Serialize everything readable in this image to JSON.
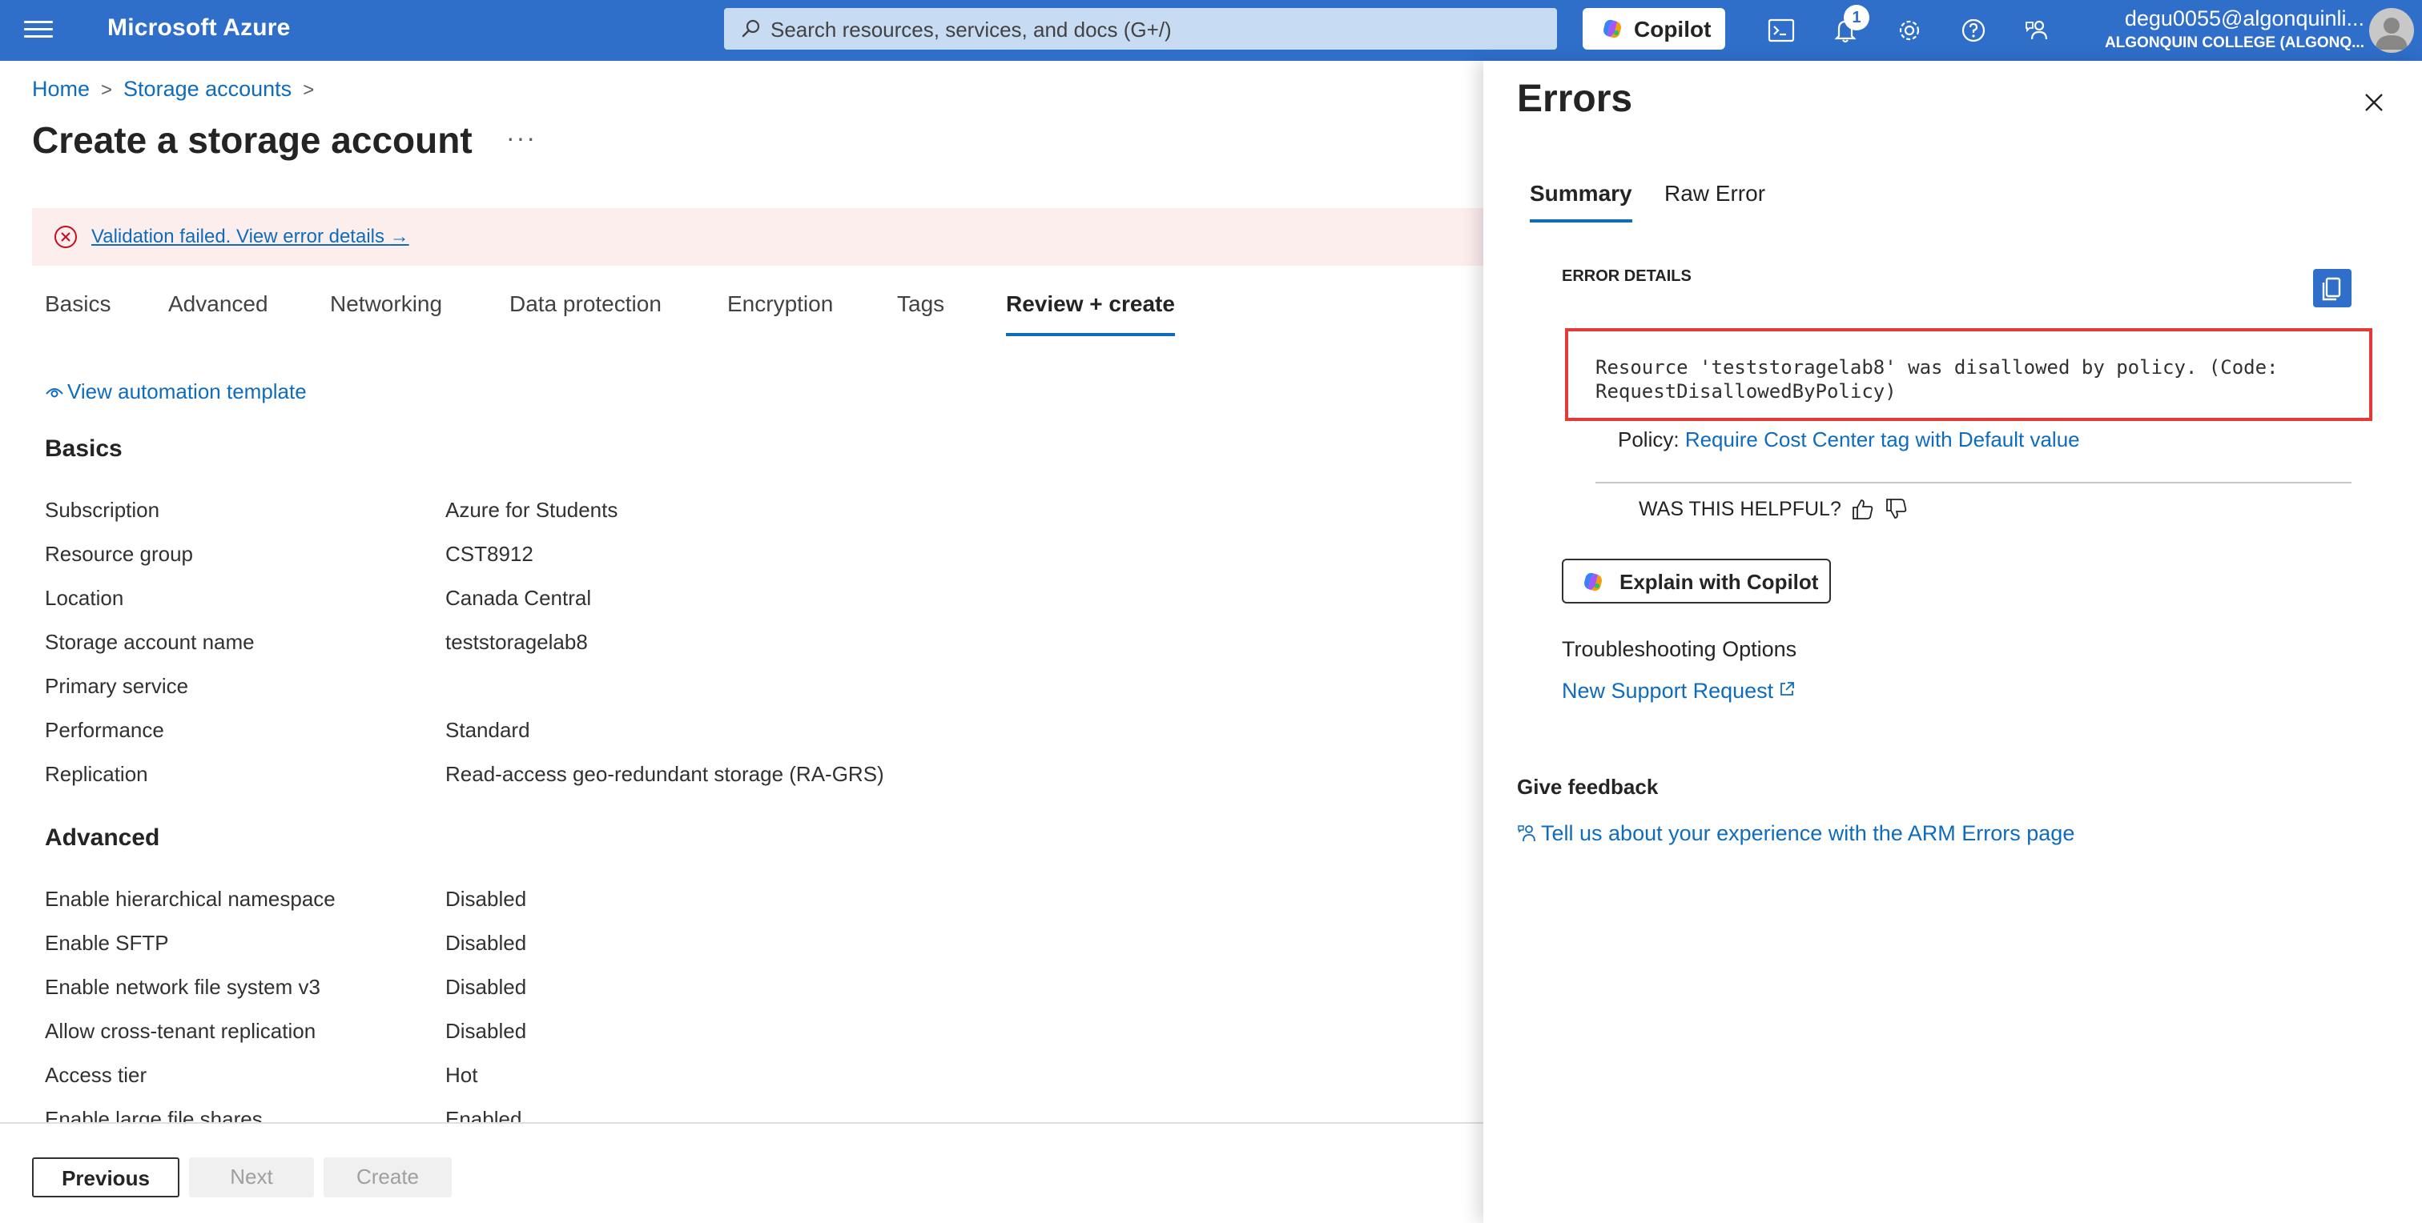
{
  "app": {
    "brand": "Microsoft Azure"
  },
  "search": {
    "placeholder": "Search resources, services, and docs (G+/)"
  },
  "copilot": {
    "label": "Copilot"
  },
  "notifications": {
    "count": "1"
  },
  "user": {
    "email": "degu0055@algonquinli...",
    "org": "ALGONQUIN COLLEGE (ALGONQ..."
  },
  "breadcrumb": {
    "home": "Home",
    "storage_accounts": "Storage accounts"
  },
  "page": {
    "title": "Create a storage account",
    "more": "···"
  },
  "banner": {
    "text": "Validation failed. View error details",
    "arrow": "→"
  },
  "tabs": [
    "Basics",
    "Advanced",
    "Networking",
    "Data protection",
    "Encryption",
    "Tags",
    "Review + create"
  ],
  "automation_link": "View automation template",
  "basics": {
    "heading": "Basics",
    "rows": [
      {
        "k": "Subscription",
        "v": "Azure for Students"
      },
      {
        "k": "Resource group",
        "v": "CST8912"
      },
      {
        "k": "Location",
        "v": "Canada Central"
      },
      {
        "k": "Storage account name",
        "v": "teststoragelab8"
      },
      {
        "k": "Primary service",
        "v": ""
      },
      {
        "k": "Performance",
        "v": "Standard"
      },
      {
        "k": "Replication",
        "v": "Read-access geo-redundant storage (RA-GRS)"
      }
    ]
  },
  "advanced": {
    "heading": "Advanced",
    "rows": [
      {
        "k": "Enable hierarchical namespace",
        "v": "Disabled"
      },
      {
        "k": "Enable SFTP",
        "v": "Disabled"
      },
      {
        "k": "Enable network file system v3",
        "v": "Disabled"
      },
      {
        "k": "Allow cross-tenant replication",
        "v": "Disabled"
      },
      {
        "k": "Access tier",
        "v": "Hot"
      },
      {
        "k": "Enable large file shares",
        "v": "Enabled"
      }
    ]
  },
  "footer": {
    "previous": "Previous",
    "next": "Next",
    "create": "Create"
  },
  "errors_panel": {
    "title": "Errors",
    "tabs": {
      "summary": "Summary",
      "raw": "Raw Error"
    },
    "details_label": "ERROR DETAILS",
    "message_line1": "Resource 'teststoragelab8' was disallowed by policy. (Code:",
    "message_line2": "RequestDisallowedByPolicy)",
    "policy_label": "Policy:",
    "policy_link": "Require Cost Center tag with Default value",
    "helpful": "WAS THIS HELPFUL?",
    "explain": "Explain with Copilot",
    "troubleshooting": "Troubleshooting Options",
    "support": "New Support Request",
    "feedback_heading": "Give feedback",
    "feedback_link": "Tell us about your experience with the ARM Errors page"
  },
  "colors": {
    "topbar": "#2f6fca",
    "link": "#0f6cbd",
    "error_red": "#e53935",
    "banner_bg": "#fdeeee"
  }
}
